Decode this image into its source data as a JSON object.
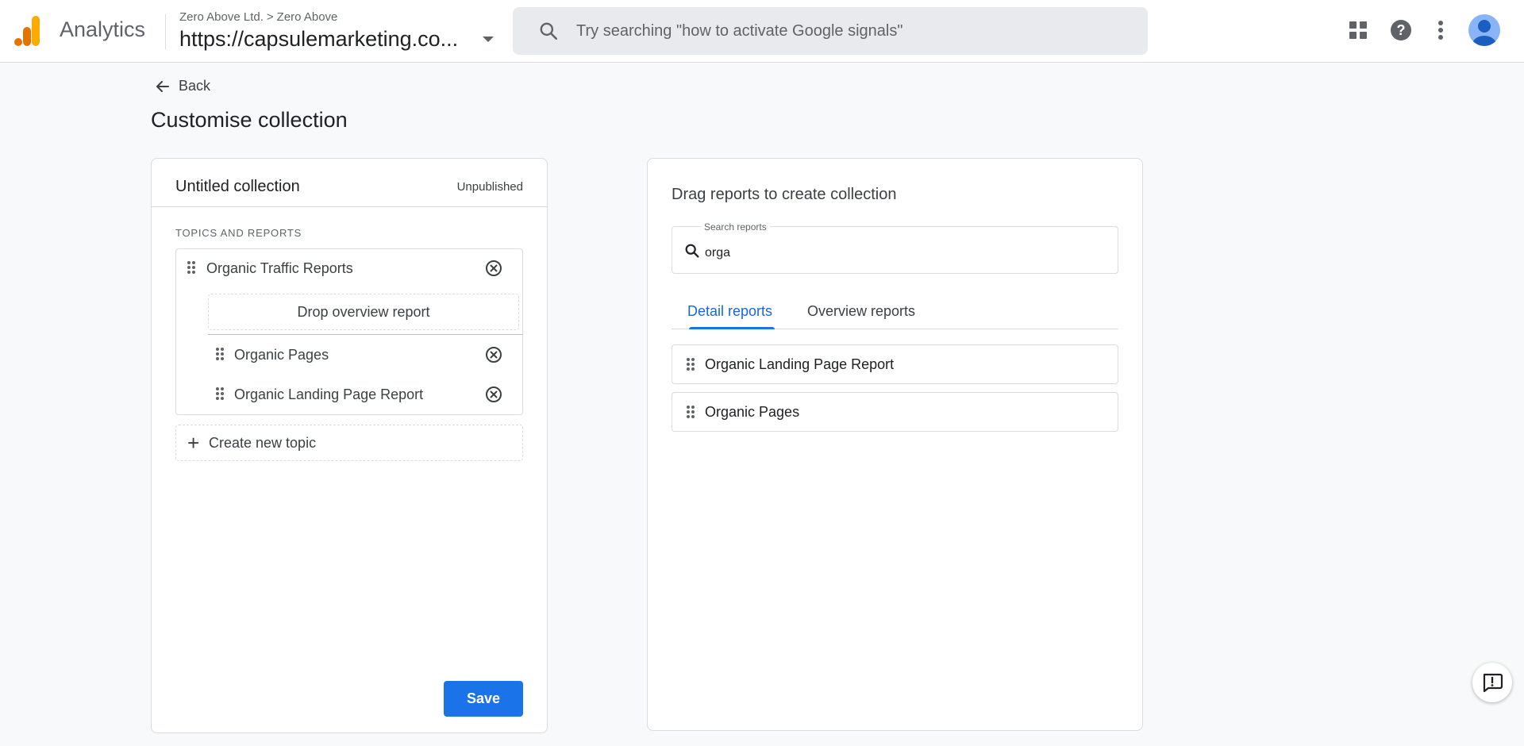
{
  "header": {
    "app_name": "Analytics",
    "breadcrumb": {
      "account": "Zero Above Ltd.",
      "separator": ">",
      "property": "Zero Above"
    },
    "property_url": "https://capsulemarketing.co...",
    "search_placeholder": "Try searching \"how to activate Google signals\"",
    "icons": [
      "apps-grid-icon",
      "help-icon",
      "more-vert-icon",
      "account-avatar"
    ]
  },
  "page": {
    "back_label": "Back",
    "title": "Customise collection"
  },
  "collection": {
    "name": "Untitled collection",
    "status": "Unpublished",
    "section_label": "TOPICS AND REPORTS",
    "topics": [
      {
        "name": "Organic Traffic Reports",
        "drop_overview_label": "Drop overview report",
        "reports": [
          {
            "name": "Organic Pages"
          },
          {
            "name": "Organic Landing Page Report"
          }
        ]
      }
    ],
    "create_topic_label": "Create new topic",
    "save_label": "Save"
  },
  "library": {
    "title": "Drag reports to create collection",
    "search_label": "Search reports",
    "search_value": "orga",
    "tabs": [
      {
        "label": "Detail reports",
        "active": true
      },
      {
        "label": "Overview reports",
        "active": false
      }
    ],
    "results": [
      {
        "name": "Organic Landing Page Report"
      },
      {
        "name": "Organic Pages"
      }
    ]
  },
  "colors": {
    "accent": "#1a73e8",
    "logo_orange": "#f9ab00",
    "logo_dark_orange": "#e37400",
    "background": "#f8f9fa",
    "border": "#dadce0"
  }
}
